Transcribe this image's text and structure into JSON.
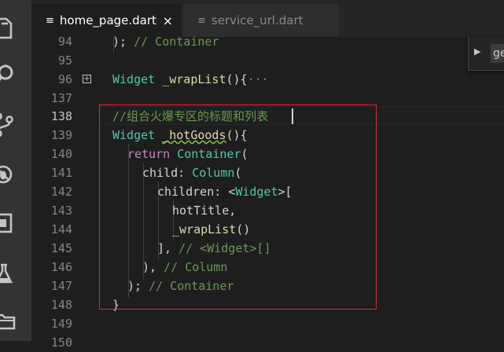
{
  "tabs": [
    {
      "label": "home_page.dart",
      "active": true,
      "close": "×"
    },
    {
      "label": "service_url.dart",
      "active": false
    }
  ],
  "find_widget": {
    "value": "ge"
  },
  "editor": {
    "current_line": 138,
    "lines": [
      {
        "num": "94",
        "text": "); // Container"
      },
      {
        "num": "95",
        "text": ""
      },
      {
        "num": "96",
        "text": "Widget _wrapList(){",
        "folded": "···"
      },
      {
        "num": "137",
        "text": ""
      },
      {
        "num": "138",
        "text": "//组合火爆专区的标题和列表"
      },
      {
        "num": "139",
        "text": "Widget _hotGoods(){"
      },
      {
        "num": "140",
        "text": "return Container("
      },
      {
        "num": "141",
        "text": "child: Column("
      },
      {
        "num": "142",
        "text": "children: <Widget>["
      },
      {
        "num": "143",
        "text": "hotTitle,"
      },
      {
        "num": "144",
        "text": "_wrapList()"
      },
      {
        "num": "145",
        "text": "], // <Widget>[]"
      },
      {
        "num": "146",
        "text": "), // Column"
      },
      {
        "num": "147",
        "text": "); // Container"
      },
      {
        "num": "148",
        "text": "}"
      },
      {
        "num": "149",
        "text": ""
      },
      {
        "num": "150",
        "text": ""
      }
    ]
  },
  "tokens": {
    "l94": {
      "close": ");",
      "cm": "// Container"
    },
    "l96": {
      "type": "Widget",
      "name": "_wrapList",
      "tail": "(){"
    },
    "l138": {
      "cm": "//组合火爆专区的标题和列表"
    },
    "l139": {
      "type": "Widget",
      "name": "_hotGoods",
      "tail": "(){"
    },
    "l140": {
      "kw": "return",
      "type": "Container",
      "tail": "("
    },
    "l141": {
      "prop": "child:",
      "type": "Column",
      "tail": "("
    },
    "l142": {
      "prop": "children:",
      "lt": "<",
      "type": "Widget",
      "tail": ">["
    },
    "l143": {
      "ident": "hotTitle,"
    },
    "l144": {
      "fn": "_wrapList",
      "tail": "()"
    },
    "l145": {
      "close": "],",
      "cm": "// <Widget>[]"
    },
    "l146": {
      "close": "),",
      "cm": "// Column"
    },
    "l147": {
      "close": ");",
      "cm": "// Container"
    },
    "l148": {
      "close": "}"
    }
  },
  "colors": {
    "keyword": "#c586c0",
    "type": "#4ec9b0",
    "function": "#dcdcaa",
    "comment": "#6a9955",
    "text": "#d4d4d4",
    "highlight_box": "#e0282c"
  },
  "icons": [
    "files-icon",
    "search-icon",
    "source-control-icon",
    "debug-icon",
    "extensions-icon",
    "flask-icon",
    "folder-icon"
  ]
}
